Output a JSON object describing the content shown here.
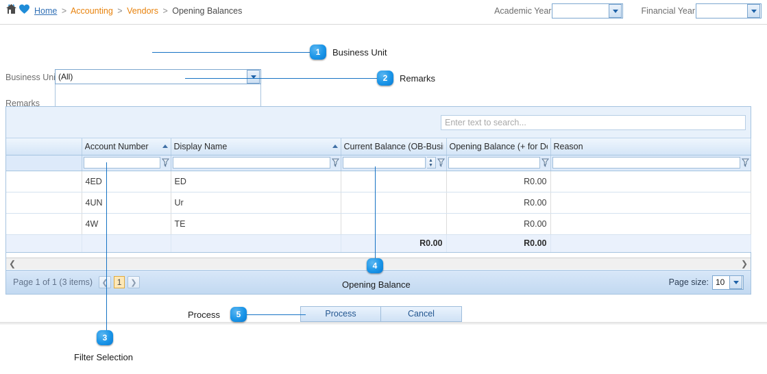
{
  "breadcrumb": {
    "home_icon": "home-icon",
    "favorite_icon": "heart-icon",
    "home": "Home",
    "sep": ">",
    "level1": "Accounting",
    "level2": "Vendors",
    "current": "Opening Balances"
  },
  "header": {
    "academic_year_label": "Academic Year",
    "academic_year_value": "",
    "financial_year_label": "Financial Year",
    "financial_year_value": "",
    "dropdown_icon": "chevron-down-icon"
  },
  "form": {
    "business_unit_label": "Business Unit",
    "business_unit_value": "(All)",
    "remarks_label": "Remarks",
    "remarks_value": "",
    "remarks_placeholder": ""
  },
  "grid": {
    "search_placeholder": "Enter text to search...",
    "search_value": "",
    "filter_icon": "funnel-icon",
    "sort_icon": "sort-ascending-icon",
    "spinner_icon": "spinner-up-down-icon",
    "columns": [
      {
        "label": "",
        "sorted": false
      },
      {
        "label": "Account Number",
        "sorted": true
      },
      {
        "label": "Display Name",
        "sorted": true
      },
      {
        "label": "Current Balance (OB-Busin",
        "sorted": false
      },
      {
        "label": "Opening Balance (+ for De",
        "sorted": false
      },
      {
        "label": "Reason",
        "sorted": false
      }
    ],
    "filters": [
      "",
      "",
      "",
      "",
      "",
      ""
    ],
    "rows": [
      {
        "sel": "",
        "account_number": "4ED",
        "display_name": "ED",
        "current_balance": "",
        "opening_balance": "R0.00",
        "reason": ""
      },
      {
        "sel": "",
        "account_number": "4UN",
        "display_name": "Ur",
        "current_balance": "",
        "opening_balance": "R0.00",
        "reason": ""
      },
      {
        "sel": "",
        "account_number": "4W",
        "display_name": "TE",
        "current_balance": "",
        "opening_balance": "R0.00",
        "reason": ""
      }
    ],
    "totals": {
      "current_balance": "R0.00",
      "opening_balance": "R0.00"
    },
    "scroll_left_icon": "chevron-left-icon",
    "scroll_right_icon": "chevron-right-icon",
    "pager": {
      "info": "Page 1 of 1 (3 items)",
      "prev_icon": "chevron-left-icon",
      "next_icon": "chevron-right-icon",
      "current_page": "1",
      "page_size_label": "Page size:",
      "page_size_value": "10"
    }
  },
  "actions": {
    "process_label": "Process",
    "cancel_label": "Cancel"
  },
  "callouts": [
    {
      "num": "1",
      "label": "Business Unit"
    },
    {
      "num": "2",
      "label": "Remarks"
    },
    {
      "num": "3",
      "label": "Filter Selection"
    },
    {
      "num": "4",
      "label": "Opening Balance"
    },
    {
      "num": "5",
      "label": "Process"
    }
  ],
  "colors": {
    "callout_blue": "#1a95e8",
    "breadcrumb_orange": "#e8820c",
    "link_blue": "#2f6fb5",
    "grid_header": "#d4e5f7",
    "pager_highlight": "#fde8b8"
  }
}
